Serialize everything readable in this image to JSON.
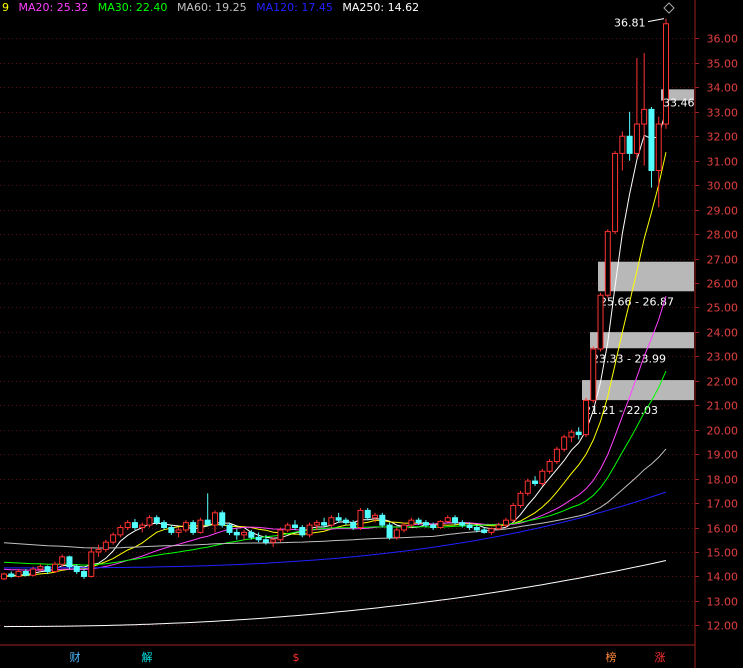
{
  "legend": {
    "items": [
      {
        "text": "9",
        "color": "#ffff00"
      },
      {
        "text": "MA20: 25.32",
        "color": "#ff40ff"
      },
      {
        "text": "MA30: 22.40",
        "color": "#00ff00"
      },
      {
        "text": "MA60: 19.25",
        "color": "#c0c0c0"
      },
      {
        "text": "MA120: 17.45",
        "color": "#2020ff"
      },
      {
        "text": "MA250: 14.62",
        "color": "#ffffff"
      }
    ]
  },
  "chart_data": {
    "type": "candlestick",
    "y_axis": {
      "ticks": [
        "36.00",
        "35.00",
        "34.00",
        "33.00",
        "32.00",
        "31.00",
        "30.00",
        "29.00",
        "28.00",
        "27.00",
        "26.00",
        "25.00",
        "24.00",
        "23.00",
        "22.00",
        "21.00",
        "20.00",
        "19.00",
        "18.00",
        "17.00",
        "16.00",
        "15.00",
        "14.00",
        "13.00",
        "12.00"
      ],
      "tick_values": [
        36,
        35,
        34,
        33,
        32,
        31,
        30,
        29,
        28,
        27,
        26,
        25,
        24,
        23,
        22,
        21,
        20,
        19,
        18,
        17,
        16,
        15,
        14,
        13,
        12
      ],
      "range": [
        11.4,
        37.0
      ]
    },
    "annotations": {
      "high_label": "36.81",
      "high_value": 36.81,
      "last_label": "33.46",
      "last_value": 33.46
    },
    "zones": [
      {
        "label": "25.66 - 26.87",
        "low": 25.66,
        "high": 26.87
      },
      {
        "label": "23.33 - 23.99",
        "low": 23.33,
        "high": 23.99
      },
      {
        "label": "21.21 - 22.03",
        "low": 21.21,
        "high": 22.03
      },
      {
        "label": "",
        "low": 33.46,
        "high": 33.92
      }
    ],
    "event_markers": [
      {
        "label": "财",
        "color": "#4fb8ff"
      },
      {
        "label": "解",
        "color": "#00e0e0"
      },
      {
        "label": "$",
        "color": "#ff3030"
      },
      {
        "label": "榜",
        "color": "#ff8a3a"
      },
      {
        "label": "涨",
        "color": "#ff3030"
      }
    ],
    "candles": [
      [
        13.9,
        14.15,
        13.85,
        14.1
      ],
      [
        14.1,
        14.2,
        13.95,
        14.0
      ],
      [
        14.0,
        14.3,
        13.95,
        14.2
      ],
      [
        14.2,
        14.3,
        14.0,
        14.05
      ],
      [
        14.05,
        14.4,
        14.0,
        14.3
      ],
      [
        14.3,
        14.5,
        14.2,
        14.4
      ],
      [
        14.4,
        14.45,
        14.1,
        14.2
      ],
      [
        14.2,
        14.6,
        14.15,
        14.5
      ],
      [
        14.5,
        14.9,
        14.4,
        14.8
      ],
      [
        14.8,
        14.85,
        14.3,
        14.4
      ],
      [
        14.4,
        14.5,
        14.1,
        14.2
      ],
      [
        14.2,
        14.3,
        13.9,
        14.0
      ],
      [
        14.0,
        15.2,
        13.95,
        15.0
      ],
      [
        15.0,
        15.3,
        14.8,
        15.1
      ],
      [
        15.1,
        15.5,
        15.0,
        15.4
      ],
      [
        15.4,
        15.8,
        15.3,
        15.7
      ],
      [
        15.7,
        16.1,
        15.6,
        16.0
      ],
      [
        16.0,
        16.3,
        15.9,
        16.2
      ],
      [
        16.2,
        16.35,
        15.9,
        16.0
      ],
      [
        16.0,
        16.2,
        15.8,
        16.1
      ],
      [
        16.1,
        16.5,
        16.0,
        16.4
      ],
      [
        16.4,
        16.5,
        16.1,
        16.2
      ],
      [
        16.2,
        16.3,
        15.9,
        16.0
      ],
      [
        16.0,
        16.1,
        15.7,
        15.8
      ],
      [
        15.8,
        16.0,
        15.6,
        15.9
      ],
      [
        15.9,
        16.3,
        15.8,
        16.2
      ],
      [
        16.2,
        16.3,
        15.7,
        15.8
      ],
      [
        15.8,
        16.4,
        15.75,
        16.3
      ],
      [
        16.3,
        17.4,
        16.2,
        16.1
      ],
      [
        16.1,
        16.7,
        15.8,
        16.6
      ],
      [
        16.6,
        16.7,
        16.0,
        16.1
      ],
      [
        16.1,
        16.2,
        15.7,
        15.8
      ],
      [
        15.8,
        15.95,
        15.5,
        15.7
      ],
      [
        15.7,
        15.9,
        15.5,
        15.8
      ],
      [
        15.8,
        15.9,
        15.5,
        15.6
      ],
      [
        15.6,
        15.8,
        15.4,
        15.5
      ],
      [
        15.5,
        15.7,
        15.3,
        15.4
      ],
      [
        15.4,
        15.6,
        15.2,
        15.5
      ],
      [
        15.5,
        16.0,
        15.4,
        15.9
      ],
      [
        15.9,
        16.2,
        15.8,
        16.1
      ],
      [
        16.1,
        16.3,
        15.9,
        16.0
      ],
      [
        16.0,
        16.1,
        15.6,
        15.7
      ],
      [
        15.7,
        16.2,
        15.6,
        16.1
      ],
      [
        16.1,
        16.3,
        15.9,
        16.2
      ],
      [
        16.2,
        16.4,
        16.0,
        16.1
      ],
      [
        16.1,
        16.5,
        16.0,
        16.4
      ],
      [
        16.4,
        16.6,
        16.2,
        16.3
      ],
      [
        16.3,
        16.4,
        16.1,
        16.2
      ],
      [
        16.2,
        16.3,
        15.9,
        16.0
      ],
      [
        16.0,
        16.8,
        15.9,
        16.7
      ],
      [
        16.7,
        16.8,
        16.3,
        16.4
      ],
      [
        16.4,
        16.6,
        16.2,
        16.5
      ],
      [
        16.5,
        16.6,
        16.0,
        16.1
      ],
      [
        16.1,
        16.2,
        15.5,
        15.6
      ],
      [
        15.6,
        16.0,
        15.5,
        15.9
      ],
      [
        15.9,
        16.2,
        15.8,
        16.1
      ],
      [
        16.1,
        16.4,
        16.0,
        16.3
      ],
      [
        16.3,
        16.4,
        16.1,
        16.2
      ],
      [
        16.2,
        16.3,
        16.0,
        16.1
      ],
      [
        16.1,
        16.2,
        15.9,
        16.0
      ],
      [
        16.0,
        16.3,
        15.95,
        16.25
      ],
      [
        16.25,
        16.5,
        16.2,
        16.4
      ],
      [
        16.4,
        16.5,
        16.1,
        16.2
      ],
      [
        16.2,
        16.3,
        16.0,
        16.1
      ],
      [
        16.1,
        16.2,
        15.9,
        16.0
      ],
      [
        16.0,
        16.1,
        15.8,
        15.9
      ],
      [
        15.9,
        16.0,
        15.75,
        15.8
      ],
      [
        15.8,
        16.0,
        15.7,
        15.95
      ],
      [
        15.95,
        16.2,
        15.9,
        16.1
      ],
      [
        16.1,
        16.4,
        16.0,
        16.3
      ],
      [
        16.3,
        17.0,
        16.2,
        16.9
      ],
      [
        16.9,
        17.5,
        16.8,
        17.4
      ],
      [
        17.4,
        18.0,
        17.3,
        17.9
      ],
      [
        17.9,
        18.1,
        17.7,
        17.8
      ],
      [
        17.8,
        18.4,
        17.7,
        18.3
      ],
      [
        18.3,
        18.8,
        18.2,
        18.7
      ],
      [
        18.7,
        19.3,
        18.6,
        19.2
      ],
      [
        19.2,
        19.8,
        19.1,
        19.7
      ],
      [
        19.7,
        20.0,
        19.5,
        19.9
      ],
      [
        19.9,
        20.1,
        19.6,
        19.8
      ],
      [
        19.8,
        21.3,
        19.7,
        21.2
      ],
      [
        21.2,
        23.4,
        21.1,
        23.3
      ],
      [
        23.3,
        25.6,
        23.2,
        25.5
      ],
      [
        25.5,
        28.2,
        25.4,
        28.1
      ],
      [
        28.1,
        31.4,
        28.0,
        31.3
      ],
      [
        31.3,
        32.2,
        30.6,
        32.0
      ],
      [
        32.0,
        33.0,
        31.0,
        31.3
      ],
      [
        31.3,
        35.2,
        31.1,
        32.5
      ],
      [
        32.5,
        35.4,
        30.8,
        33.1
      ],
      [
        33.1,
        33.2,
        29.9,
        30.6
      ],
      [
        30.6,
        32.8,
        29.1,
        32.5
      ],
      [
        32.5,
        36.81,
        32.3,
        36.6
      ]
    ],
    "ma_series": [
      {
        "name": "MA5",
        "color": "#ffffff",
        "period": 5
      },
      {
        "name": "MA10",
        "color": "#ffff00",
        "period": 10
      },
      {
        "name": "MA20",
        "color": "#ff40ff",
        "period": 20
      },
      {
        "name": "MA30",
        "color": "#00ff00",
        "period": 30
      },
      {
        "name": "MA60",
        "color": "#c0c0c0",
        "period": 60
      },
      {
        "name": "MA120",
        "color": "#2020ff",
        "period": 120
      },
      {
        "name": "MA250",
        "color": "#ffffff",
        "period": 250
      }
    ]
  }
}
